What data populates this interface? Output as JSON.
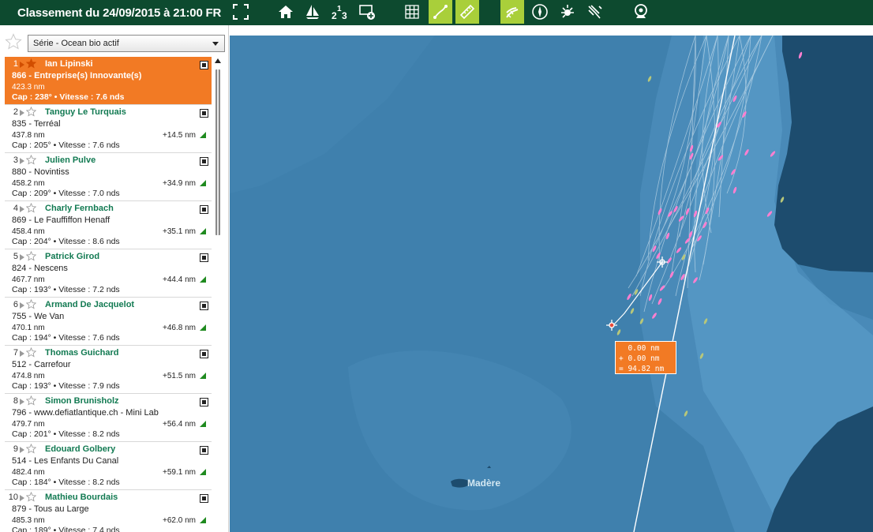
{
  "header": {
    "title": "Classement du 24/09/2015 à 21:00 FR",
    "toolbar": [
      {
        "icon": "fullscreen-icon"
      },
      {
        "icon": "home-icon"
      },
      {
        "icon": "sailboat-icon"
      },
      {
        "icon": "ranking-icon"
      },
      {
        "icon": "add-layer-icon"
      },
      {
        "icon": "grid-icon"
      },
      {
        "icon": "route-icon",
        "active": true
      },
      {
        "icon": "ruler-icon",
        "active": true
      },
      {
        "icon": "wind-icon",
        "active": true
      },
      {
        "icon": "compass-icon"
      },
      {
        "icon": "sun-icon"
      },
      {
        "icon": "swell-icon"
      },
      {
        "icon": "webcam-icon"
      }
    ]
  },
  "filter": {
    "selected": "Série - Ocean bio actif"
  },
  "ranking": [
    {
      "pos": "1",
      "name": "Ian Lipinski",
      "boat": "866 - Entreprise(s) Innovante(s)",
      "dist": "423.3 nm",
      "gap": "",
      "heading": "Cap : 238° • Vitesse : 7.6 nds"
    },
    {
      "pos": "2",
      "name": "Tanguy Le Turquais",
      "boat": "835 - Terréal",
      "dist": "437.8 nm",
      "gap": "+14.5 nm",
      "heading": "Cap : 205° • Vitesse : 7.6 nds"
    },
    {
      "pos": "3",
      "name": "Julien Pulve",
      "boat": "880 - Novintiss",
      "dist": "458.2 nm",
      "gap": "+34.9 nm",
      "heading": "Cap : 209° • Vitesse : 7.0 nds"
    },
    {
      "pos": "4",
      "name": "Charly Fernbach",
      "boat": "869 - Le Fauffiffon Henaff",
      "dist": "458.4 nm",
      "gap": "+35.1 nm",
      "heading": "Cap : 204° • Vitesse : 8.6 nds"
    },
    {
      "pos": "5",
      "name": "Patrick Girod",
      "boat": "824 - Nescens",
      "dist": "467.7 nm",
      "gap": "+44.4 nm",
      "heading": "Cap : 193° • Vitesse : 7.2 nds"
    },
    {
      "pos": "6",
      "name": "Armand De Jacquelot",
      "boat": "755 - We Van",
      "dist": "470.1 nm",
      "gap": "+46.8 nm",
      "heading": "Cap : 194° • Vitesse : 7.6 nds"
    },
    {
      "pos": "7",
      "name": "Thomas Guichard",
      "boat": "512 - Carrefour",
      "dist": "474.8 nm",
      "gap": "+51.5 nm",
      "heading": "Cap : 193° • Vitesse : 7.9 nds"
    },
    {
      "pos": "8",
      "name": "Simon Brunisholz",
      "boat": "796 - www.defiatlantique.ch - Mini Lab",
      "dist": "479.7 nm",
      "gap": "+56.4 nm",
      "heading": "Cap : 201° • Vitesse : 8.2 nds"
    },
    {
      "pos": "9",
      "name": "Edouard Golbery",
      "boat": "514 - Les Enfants Du Canal",
      "dist": "482.4 nm",
      "gap": "+59.1 nm",
      "heading": "Cap : 184° • Vitesse : 8.2 nds"
    },
    {
      "pos": "10",
      "name": "Mathieu Bourdais",
      "boat": "879 - Tous au Large",
      "dist": "485.3 nm",
      "gap": "+62.0 nm",
      "heading": "Cap : 189° • Vitesse : 7.4 nds"
    }
  ],
  "map": {
    "island_label": "Madère",
    "measure": {
      "line1": "  0.00 nm",
      "line2": "+ 0.00 nm",
      "line3": "= 94.82 nm"
    },
    "colors": {
      "ocean": "#3f80ad",
      "land": "#1d4c6e",
      "leader_boat": "#ff7fd0",
      "other_boat": "#b7c77a"
    }
  }
}
